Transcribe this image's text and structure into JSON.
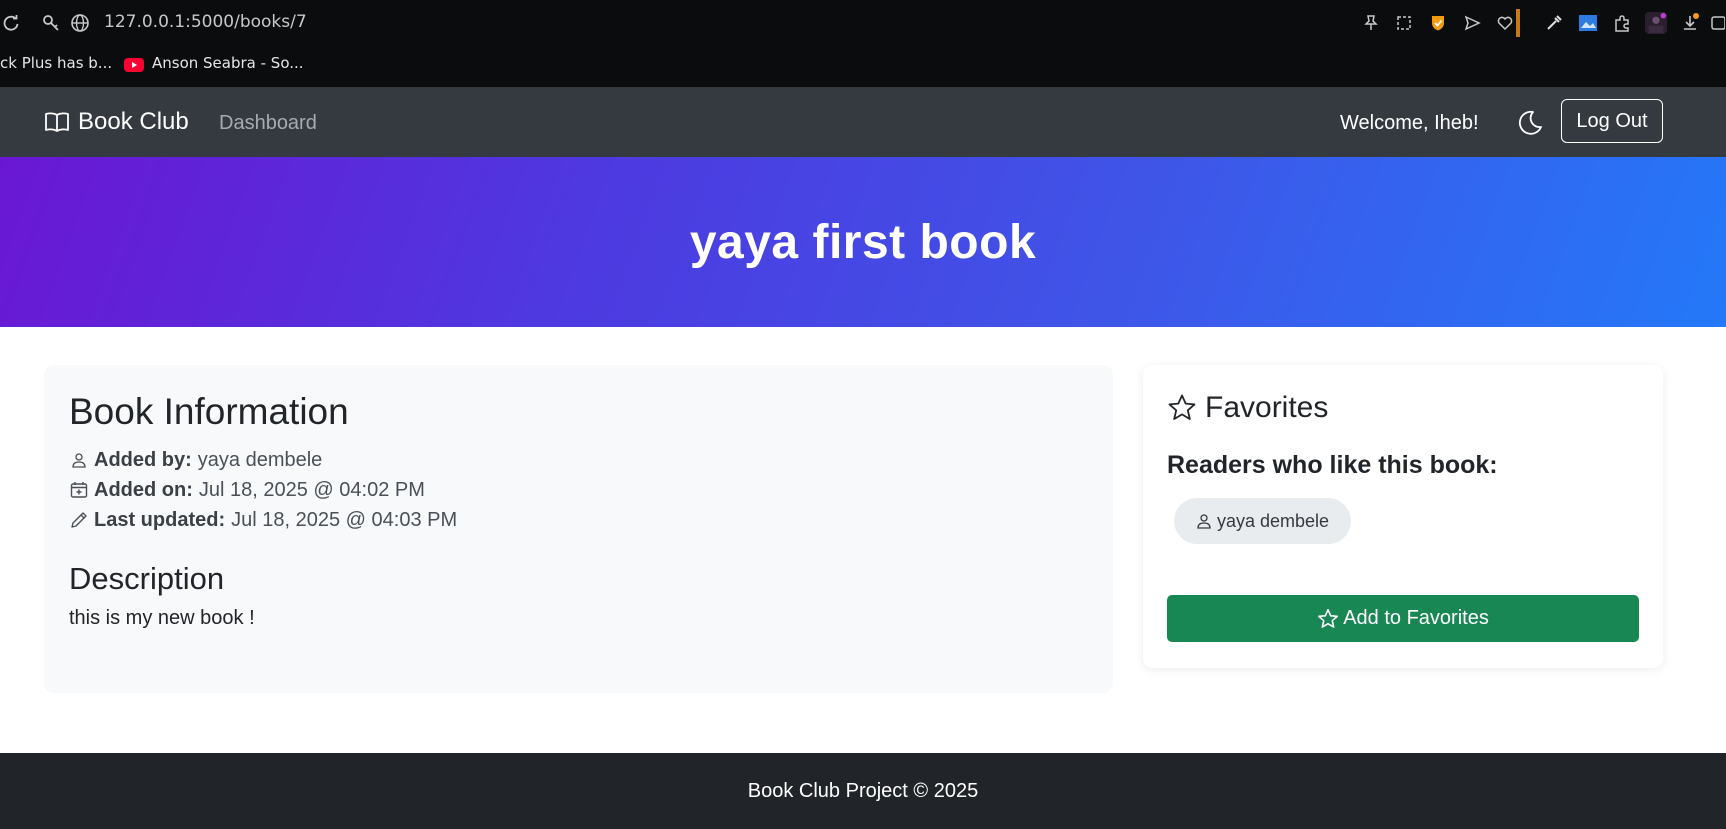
{
  "browser": {
    "url": "127.0.0.1:5000/books/7",
    "bookmarks": [
      {
        "label": "ck Plus has b..."
      },
      {
        "label": "Anson Seabra - So..."
      }
    ]
  },
  "navbar": {
    "brand": "Book Club",
    "dashboard_link": "Dashboard",
    "welcome": "Welcome, Iheb!",
    "logout_label": "Log Out"
  },
  "hero": {
    "title": "yaya first book"
  },
  "info": {
    "heading": "Book Information",
    "added_by_label": "Added by:",
    "added_by_value": "yaya dembele",
    "added_on_label": "Added on:",
    "added_on_value": "Jul 18, 2025 @ 04:02 PM",
    "updated_label": "Last updated:",
    "updated_value": "Jul 18, 2025 @ 04:03 PM",
    "description_heading": "Description",
    "description": "this is my new book !"
  },
  "favorites": {
    "heading": "Favorites",
    "subheading": "Readers who like this book:",
    "readers": [
      "yaya dembele"
    ],
    "add_button_label": "Add to Favorites"
  },
  "footer": {
    "text": "Book Club Project © 2025"
  },
  "colors": {
    "navbar_bg": "#343a40",
    "hero_gradient_start": "#6a17d3",
    "hero_gradient_end": "#2478f9",
    "success": "#198754",
    "footer_bg": "#212529"
  }
}
